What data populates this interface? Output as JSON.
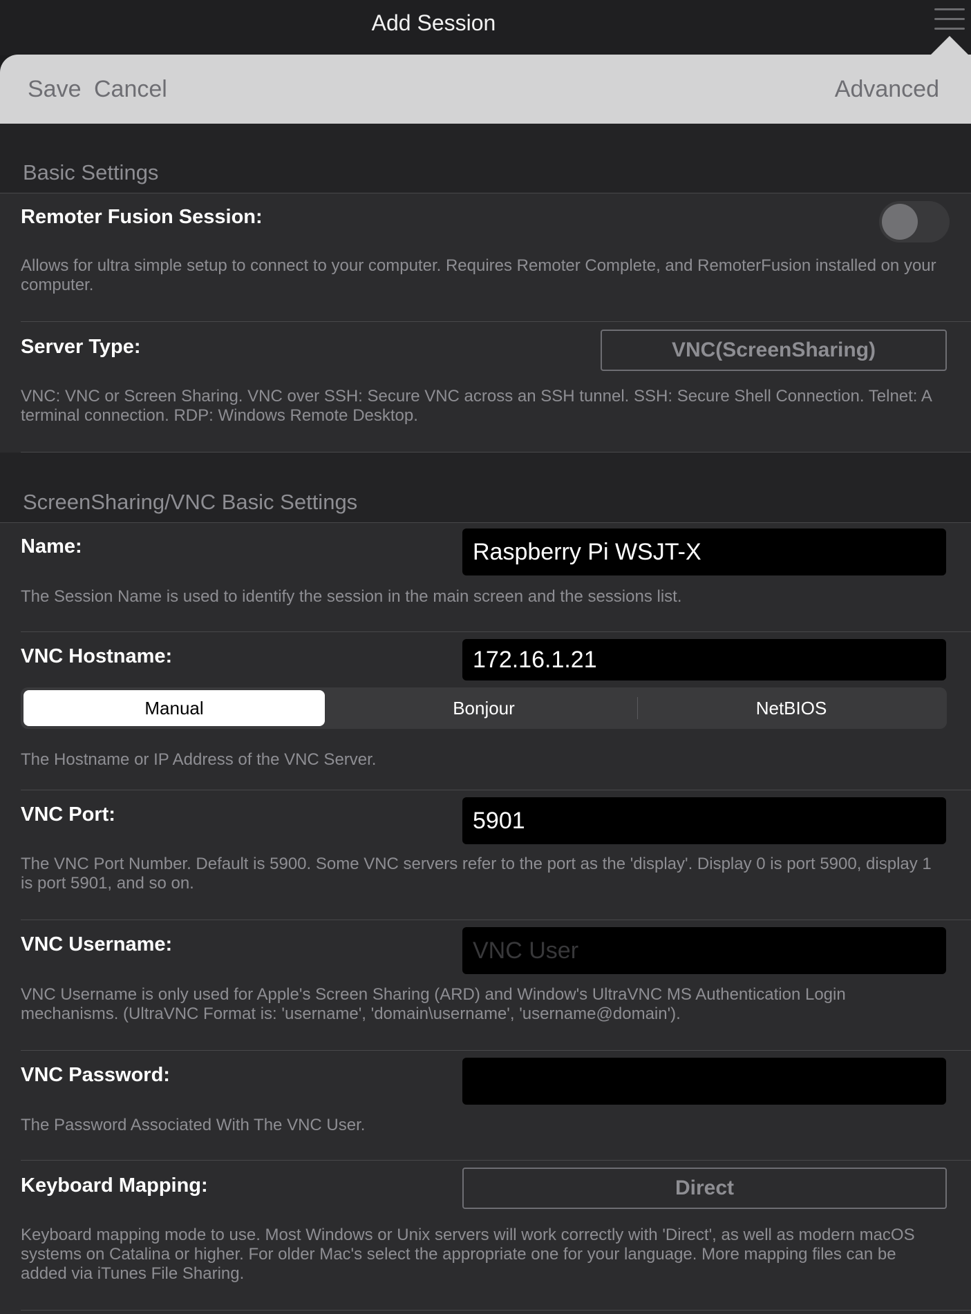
{
  "window": {
    "title": "Add Session"
  },
  "toolbar": {
    "save_label": "Save",
    "cancel_label": "Cancel",
    "advanced_label": "Advanced"
  },
  "sections": {
    "basic": {
      "header": "Basic Settings"
    },
    "vnc": {
      "header": "ScreenSharing/VNC Basic Settings"
    }
  },
  "fusion": {
    "label": "Remoter Fusion Session:",
    "enabled": false,
    "description": "Allows for ultra simple setup to connect to your computer. Requires Remoter Complete, and RemoterFusion installed on your computer."
  },
  "server_type": {
    "label": "Server Type:",
    "value": "VNC(ScreenSharing)",
    "description": "VNC: VNC or Screen Sharing. VNC over SSH: Secure VNC across an SSH tunnel. SSH: Secure Shell Connection. Telnet: A terminal connection. RDP: Windows Remote Desktop."
  },
  "name": {
    "label": "Name:",
    "value": "Raspberry Pi WSJT-X",
    "description": "The Session Name is used to identify the session in the main screen and the sessions list."
  },
  "hostname": {
    "label": "VNC Hostname:",
    "value": "172.16.1.21",
    "modes": [
      "Manual",
      "Bonjour",
      "NetBIOS"
    ],
    "selected_mode": "Manual",
    "description": "The Hostname or IP Address of the VNC Server."
  },
  "port": {
    "label": "VNC Port:",
    "value": "5901",
    "description": "The VNC Port Number. Default is 5900. Some VNC servers refer to the port as the 'display'. Display 0 is port 5900, display 1 is port 5901, and so on."
  },
  "username": {
    "label": "VNC Username:",
    "value": "",
    "placeholder": "VNC User",
    "description": "VNC Username is only used for Apple's Screen Sharing (ARD) and Window's UltraVNC MS Authentication Login mechanisms. (UltraVNC Format is: 'username', 'domain\\username', 'username@domain')."
  },
  "password": {
    "label": "VNC Password:",
    "value": "",
    "description": "The Password Associated With The VNC User."
  },
  "keyboard": {
    "label": "Keyboard Mapping:",
    "value": "Direct",
    "description": "Keyboard mapping mode to use. Most Windows or Unix servers will work correctly with 'Direct', as well as modern macOS systems on Catalina or higher. For older Mac's select the appropriate one for your language. More mapping files can be added via iTunes File Sharing."
  },
  "icons": {
    "menu": "hamburger-menu-icon"
  }
}
